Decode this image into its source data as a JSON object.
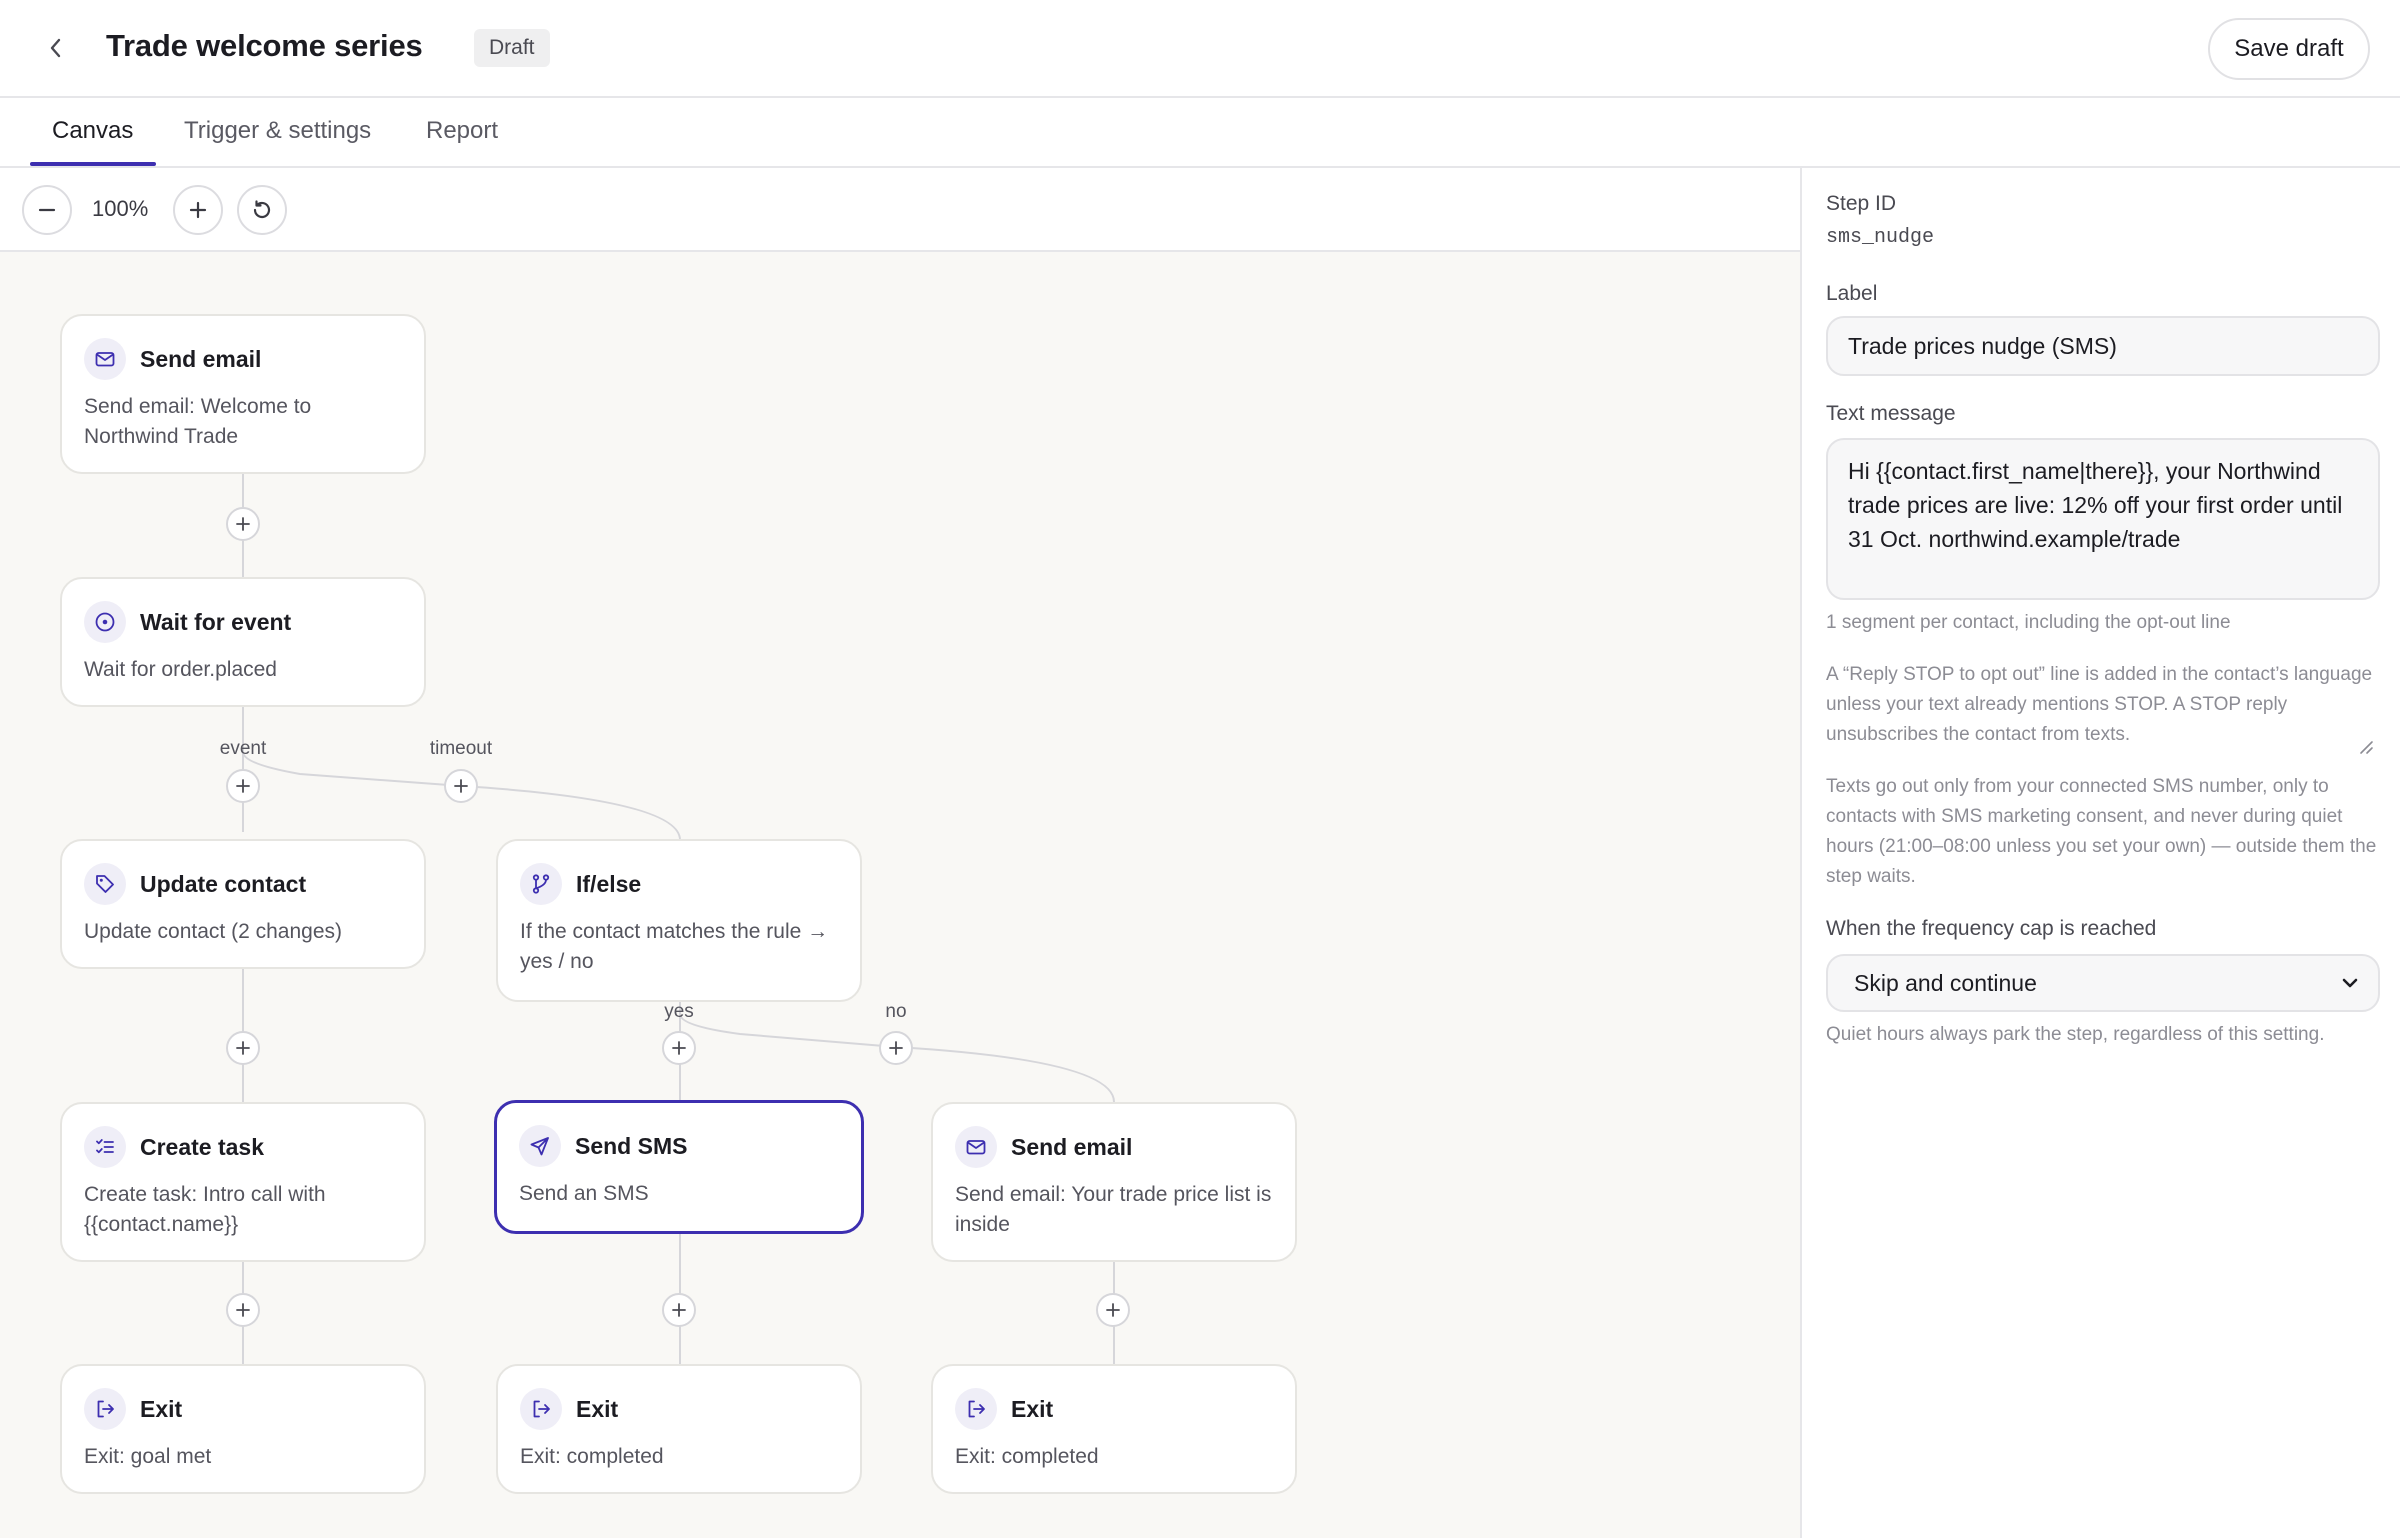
{
  "header": {
    "title": "Trade welcome series",
    "status_badge": "Draft",
    "save_label": "Save draft"
  },
  "tabs": [
    {
      "label": "Canvas",
      "active": true
    },
    {
      "label": "Trigger & settings",
      "active": false
    },
    {
      "label": "Report",
      "active": false
    }
  ],
  "toolbar": {
    "zoom_level": "100%"
  },
  "canvas": {
    "nodes": [
      {
        "id": "n1",
        "title": "Send email",
        "description": "Send email: Welcome to Northwind Trade",
        "icon": "mail-icon"
      },
      {
        "id": "n2",
        "title": "Wait for event",
        "description": "Wait for order.placed",
        "icon": "clock-icon"
      },
      {
        "id": "n3",
        "title": "Update contact",
        "description": "Update contact (2 changes)",
        "icon": "tag-icon"
      },
      {
        "id": "n4",
        "title": "If/else",
        "description": "If the contact matches the rule → yes / no",
        "icon": "branch-icon"
      },
      {
        "id": "n5",
        "title": "Create task",
        "description": "Create task: Intro call with {{contact.name}}",
        "icon": "checklist-icon"
      },
      {
        "id": "n6",
        "title": "Send SMS",
        "description": "Send an SMS",
        "icon": "send-icon",
        "selected": true
      },
      {
        "id": "n7",
        "title": "Send email",
        "description": "Send email: Your trade price list is inside",
        "icon": "mail-icon"
      },
      {
        "id": "n8",
        "title": "Exit",
        "description": "Exit: goal met",
        "icon": "exit-icon"
      },
      {
        "id": "n9",
        "title": "Exit",
        "description": "Exit: completed",
        "icon": "exit-icon"
      },
      {
        "id": "n10",
        "title": "Exit",
        "description": "Exit: completed",
        "icon": "exit-icon"
      }
    ],
    "edge_labels": {
      "event": "event",
      "timeout": "timeout",
      "yes": "yes",
      "no": "no"
    }
  },
  "panel": {
    "step_id_label": "Step ID",
    "step_id_value": "sms_nudge",
    "label_label": "Label",
    "label_value": "Trade prices nudge (SMS)",
    "text_message_label": "Text message",
    "text_message_value": "Hi {{contact.first_name|there}}, your Northwind trade prices are live: 12% off your first order until 31 Oct. northwind.example/trade",
    "segment_help": "1 segment per contact, including the opt-out line",
    "stop_help": "A “Reply STOP to opt out” line is added in the contact’s language unless your text already mentions STOP. A STOP reply unsubscribes the contact from texts.",
    "consent_help": "Texts go out only from your connected SMS number, only to contacts with SMS marketing consent, and never during quiet hours (21:00–08:00 unless you set your own) — outside them the step waits.",
    "frequency_label": "When the frequency cap is reached",
    "frequency_value": "Skip and continue",
    "quiet_help": "Quiet hours always park the step, regardless of this setting."
  },
  "colors": {
    "accent": "#3d2fb0",
    "canvas_bg": "#f9f8f5",
    "icon_bg": "#efeef7"
  }
}
